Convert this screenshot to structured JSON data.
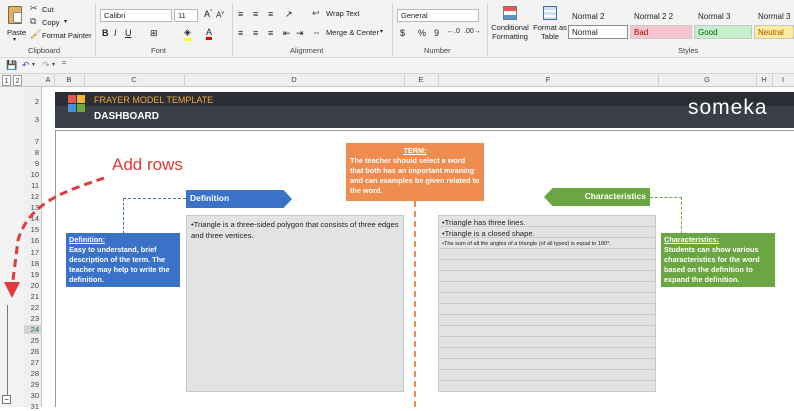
{
  "ribbon": {
    "clipboard": {
      "paste": "Paste",
      "cut": "Cut",
      "copy": "Copy",
      "format_painter": "Format Painter",
      "group": "Clipboard"
    },
    "font": {
      "family": "Calibri",
      "size": "11",
      "group": "Font"
    },
    "alignment": {
      "wrap_text": "Wrap Text",
      "merge_center": "Merge & Center",
      "group": "Alignment"
    },
    "number": {
      "format": "General",
      "group": "Number",
      "percent": "%",
      "comma": "9",
      "currency": "$"
    },
    "styles": {
      "conditional": "Conditional Formatting",
      "format_as_table": "Format as Table",
      "group": "Styles",
      "row1": [
        "Normal 2",
        "Normal 2 2",
        "Normal 3",
        "Normal 3 2"
      ],
      "row2": [
        "Normal",
        "Bad",
        "Good",
        "Neutral"
      ]
    }
  },
  "outline_levels": [
    "1",
    "2"
  ],
  "columns": [
    "A",
    "B",
    "C",
    "D",
    "E",
    "F",
    "G",
    "H"
  ],
  "rows_top": [
    "2",
    "3"
  ],
  "rows": [
    "7",
    "8",
    "9",
    "10",
    "11",
    "12",
    "13",
    "14",
    "15",
    "16",
    "17",
    "18",
    "19",
    "20",
    "21",
    "22",
    "23",
    "24",
    "25",
    "26",
    "27",
    "28",
    "29",
    "30",
    "31"
  ],
  "dashboard": {
    "template_title": "FRAYER MODEL TEMPLATE",
    "subtitle": "DASHBOARD",
    "brand": "someka",
    "add_rows": "Add rows",
    "definition_header": "Definition",
    "characteristics_header": "Characteristics",
    "term_title": "TERM:",
    "term_text": "The teacher should select a word that both has an important meaning and can examples be given related to the word.",
    "definition_note_title": "Definition:",
    "definition_note_text": "Easy to understand, brief description of the term. The teacher may help to write the definition.",
    "characteristics_note_title": "Characteristics:",
    "characteristics_note_text": "Students can show various characteristics for the word based on the definition to expand the definition.",
    "definition_content": "•Triangle is a three-sided polygon that consists of three edges and three vertices.",
    "characteristics_items": [
      "•Triangle has three lines.",
      "•Triangle is a closed shape.",
      "•The sum of all the angles of a triangle (of all types) is equal to 180°."
    ]
  },
  "colors": {
    "blue": "#3a72c7",
    "green": "#6aa642",
    "orange": "#ef8c4f",
    "red_annotation": "#e03a3a",
    "banner": "#3b3f47"
  }
}
